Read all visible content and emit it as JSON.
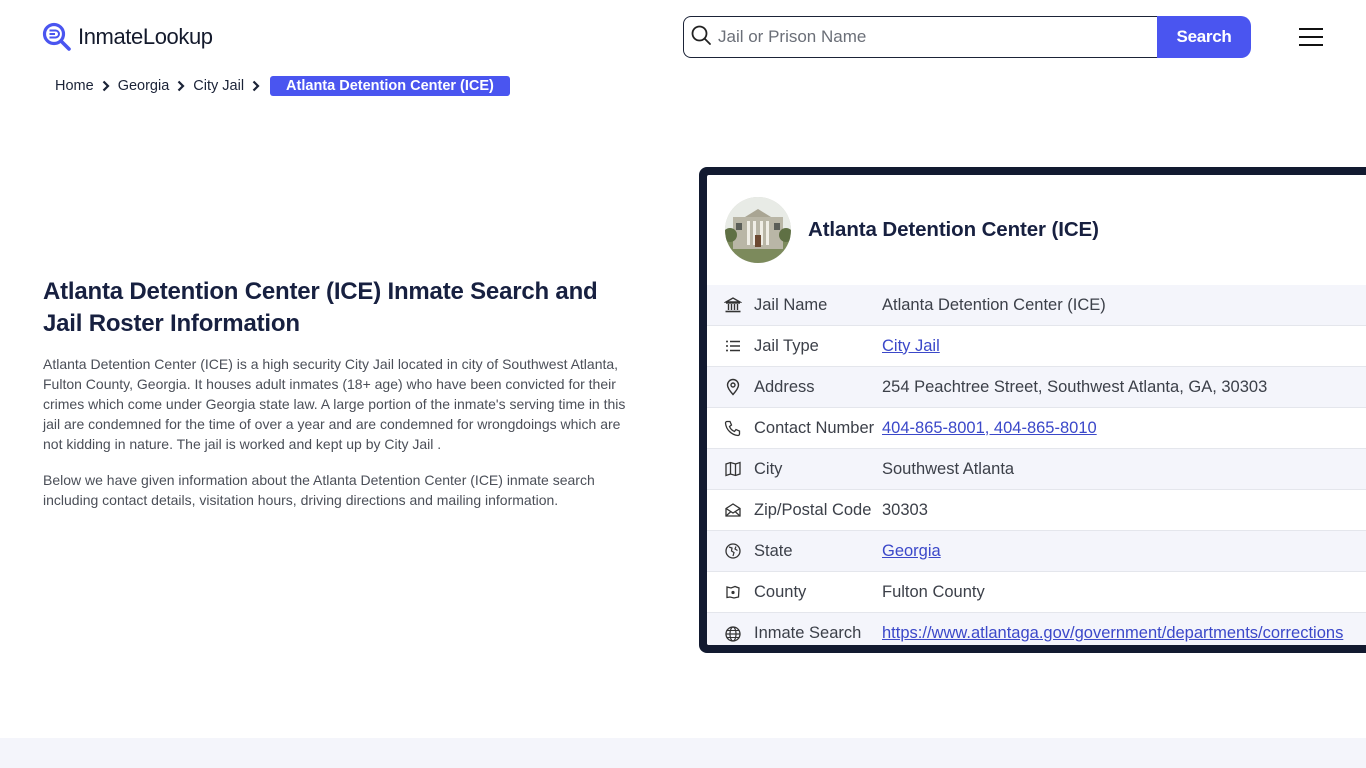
{
  "header": {
    "logo_text": "InmateLookup",
    "search_placeholder": "Jail or Prison Name",
    "search_value": "",
    "search_button": "Search",
    "menu_icon": "hamburger-menu-icon"
  },
  "breadcrumb": {
    "items": [
      "Home",
      "Georgia",
      "City Jail"
    ],
    "current": "Atlanta Detention Center (ICE)"
  },
  "intro": {
    "title": "Atlanta Detention Center (ICE) Inmate Search and Jail Roster Information",
    "paragraph1": "Atlanta Detention Center (ICE) is a high security City Jail located in city of Southwest Atlanta, Fulton County, Georgia. It houses adult inmates (18+ age) who have been convicted for their crimes which come under Georgia state law. A large portion of the inmate's serving time in this jail are condemned for the time of over a year and are condemned for wrongdoings which are not kidding in nature. The jail is worked and kept up by City Jail .",
    "paragraph2": "Below we have given information about the Atlanta Detention Center (ICE) inmate search including contact details, visitation hours, driving directions and mailing information."
  },
  "card": {
    "title": "Atlanta Detention Center (ICE)",
    "rows": [
      {
        "icon": "building-icon",
        "label": "Jail Name",
        "value": "Atlanta Detention Center (ICE)",
        "link": false
      },
      {
        "icon": "list-icon",
        "label": "Jail Type",
        "value": "City Jail",
        "link": true
      },
      {
        "icon": "map-pin-icon",
        "label": "Address",
        "value": "254 Peachtree Street, Southwest Atlanta, GA, 30303",
        "link": false
      },
      {
        "icon": "phone-icon",
        "label": "Contact Number",
        "value": "404-865-8001, 404-865-8010",
        "link": true
      },
      {
        "icon": "map-icon",
        "label": "City",
        "value": "Southwest Atlanta",
        "link": false
      },
      {
        "icon": "mail-open-icon",
        "label": "Zip/Postal Code",
        "value": "30303",
        "link": false
      },
      {
        "icon": "globe-map-icon",
        "label": "State",
        "value": "Georgia",
        "link": true
      },
      {
        "icon": "county-map-icon",
        "label": "County",
        "value": "Fulton County",
        "link": false
      },
      {
        "icon": "web-globe-icon",
        "label": "Inmate Search",
        "value": "https://www.atlantaga.gov/government/departments/corrections",
        "link": true
      }
    ]
  },
  "colors": {
    "accent": "#4a55f0",
    "card_border": "#121a30",
    "link": "#3b48c9",
    "row_alt": "#f4f5fb"
  }
}
